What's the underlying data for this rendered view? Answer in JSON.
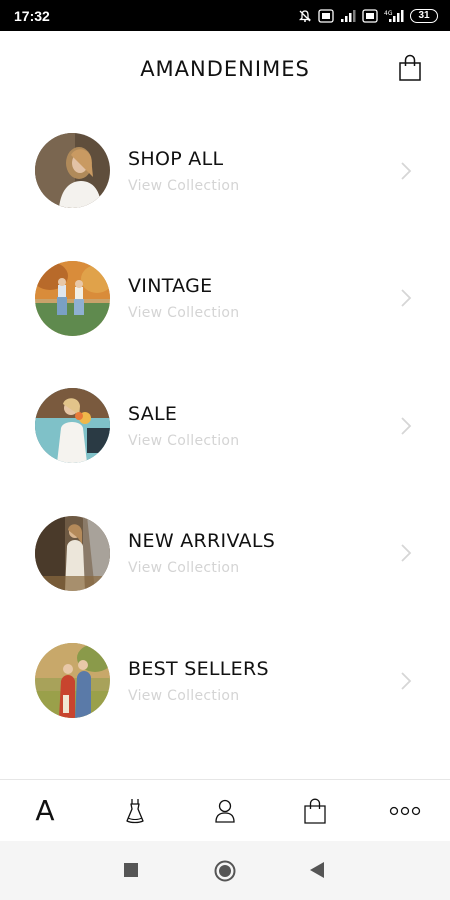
{
  "status_bar": {
    "time": "17:32",
    "battery": "31",
    "network_label": "4G",
    "icons": [
      "mute-icon",
      "volte-icon",
      "signal-icon",
      "volte-icon",
      "signal-4g-icon",
      "battery-icon"
    ]
  },
  "header": {
    "title": "AMANDENIMES",
    "cart_icon": "shopping-bag-icon"
  },
  "collections": [
    {
      "title": "SHOP ALL",
      "subtitle": "View Collection"
    },
    {
      "title": "VINTAGE",
      "subtitle": "View Collection"
    },
    {
      "title": "SALE",
      "subtitle": "View Collection"
    },
    {
      "title": "NEW ARRIVALS",
      "subtitle": "View Collection"
    },
    {
      "title": "BEST SELLERS",
      "subtitle": "View Collection"
    }
  ],
  "bottom_nav": {
    "home_label": "A",
    "items": [
      "home-logo-icon",
      "dress-icon",
      "account-icon",
      "shopping-bag-icon",
      "more-icon"
    ]
  },
  "system_nav": {
    "items": [
      "recents-square-icon",
      "home-circle-icon",
      "back-triangle-icon"
    ]
  },
  "colors": {
    "status_bar": "#000000",
    "text": "#111111",
    "subtitle": "#d4d4d4",
    "chevron": "#d6d6d6",
    "system_nav_bg": "#f5f5f5"
  }
}
